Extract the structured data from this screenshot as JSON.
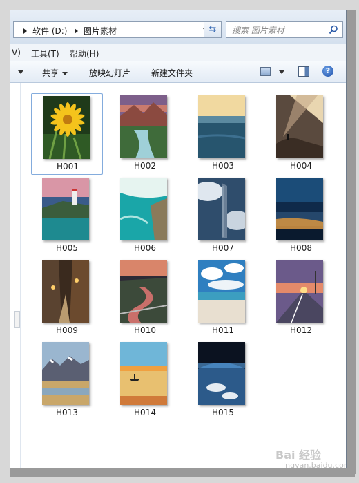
{
  "breadcrumb": [
    "软件 (D:)",
    "图片素材"
  ],
  "search": {
    "placeholder": "搜索 图片素材"
  },
  "menu": [
    {
      "label": "V)"
    },
    {
      "label": "工具(T)"
    },
    {
      "label": "帮助(H)"
    }
  ],
  "toolbar": {
    "share_label": "共享",
    "slideshow_label": "放映幻灯片",
    "new_folder_label": "新建文件夹"
  },
  "files": [
    {
      "name": "H001",
      "icon": "flower-photo",
      "selected": true
    },
    {
      "name": "H002",
      "icon": "river-valley-photo"
    },
    {
      "name": "H003",
      "icon": "ocean-horizon-photo"
    },
    {
      "name": "H004",
      "icon": "cliff-sunrays-photo"
    },
    {
      "name": "H005",
      "icon": "lighthouse-photo"
    },
    {
      "name": "H006",
      "icon": "turquoise-sea-photo"
    },
    {
      "name": "H007",
      "icon": "skyscraper-clouds-photo"
    },
    {
      "name": "H008",
      "icon": "night-city-photo"
    },
    {
      "name": "H009",
      "icon": "street-lanterns-photo"
    },
    {
      "name": "H010",
      "icon": "canyon-bridge-photo"
    },
    {
      "name": "H011",
      "icon": "beach-sky-photo"
    },
    {
      "name": "H012",
      "icon": "road-sunset-photo"
    },
    {
      "name": "H013",
      "icon": "mountain-lake-photo"
    },
    {
      "name": "H014",
      "icon": "boat-sunset-photo"
    },
    {
      "name": "H015",
      "icon": "earth-from-space-photo"
    }
  ],
  "watermark": {
    "text": "Bai 经验",
    "sub": "jingyan.baidu.com"
  },
  "colors": {
    "accent": "#3b6db5",
    "selection_border": "#84acdd"
  }
}
